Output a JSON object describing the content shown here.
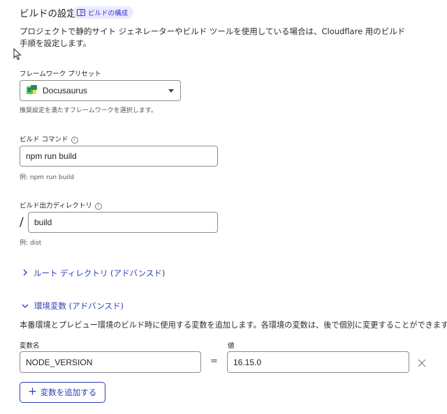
{
  "header": {
    "title": "ビルドの設定",
    "badge_label": "ビルドの構成"
  },
  "description": "プロジェクトで静的サイト ジェネレーターやビルド ツールを使用している場合は、Cloudflare 用のビルド手順を設定します。",
  "framework": {
    "label": "フレームワーク プリセット",
    "selected": "Docusaurus",
    "hint": "推奨設定を満たすフレームワークを選択します。"
  },
  "build_command": {
    "label": "ビルド コマンド",
    "value": "npm run build",
    "hint": "例: npm run build"
  },
  "output_dir": {
    "label": "ビルド出力ディレクトリ",
    "prefix": "/",
    "value": "build",
    "hint": "例: dist"
  },
  "root_dir": {
    "label": "ルート ディレクトリ (アドバンスド)"
  },
  "env_vars": {
    "label": "環境変数 (アドバンスド)",
    "description": "本番環境とプレビュー環境のビルド時に使用する変数を追加します。各環境の変数は、後で個別に変更することができます。",
    "name_header": "変数名",
    "value_header": "値",
    "equals": "=",
    "rows": [
      {
        "name": "NODE_VERSION",
        "value": "16.15.0"
      }
    ],
    "add_label": "変数を追加する"
  },
  "colors": {
    "accent": "#2d3bb8",
    "badge_bg": "#eceaff"
  }
}
